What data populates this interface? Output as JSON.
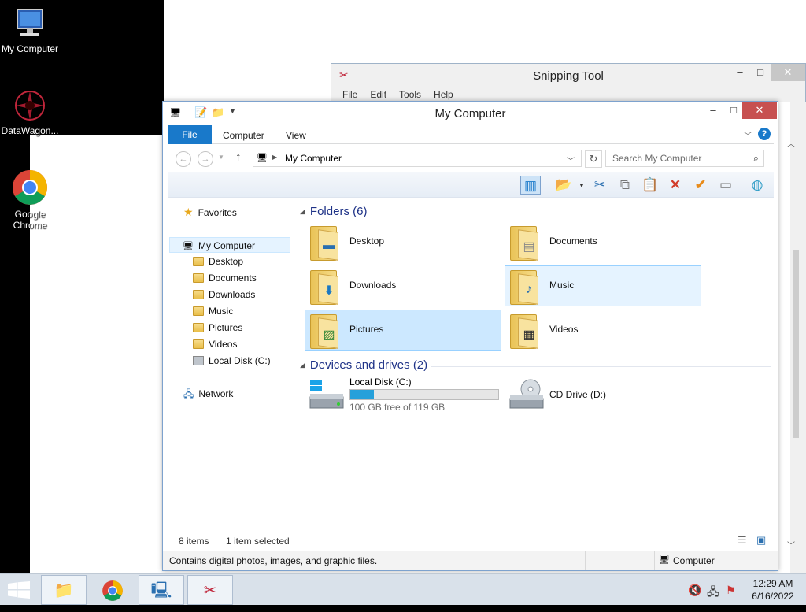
{
  "desktop": {
    "icons": [
      {
        "label": "My Computer",
        "icon": "computer-icon"
      },
      {
        "label": "DataWagon...",
        "icon": "datawagon-icon"
      },
      {
        "label": "Google Chrome",
        "icon": "chrome-icon"
      }
    ]
  },
  "snipping_tool": {
    "title": "Snipping Tool",
    "menu": [
      "File",
      "Edit",
      "Tools",
      "Help"
    ],
    "controls": {
      "minimize": "–",
      "maximize": "□",
      "close": "✕"
    }
  },
  "explorer": {
    "title": "My Computer",
    "controls": {
      "minimize": "–",
      "maximize": "□",
      "close": "✕"
    },
    "ribbon_tabs": [
      "File",
      "Computer",
      "View"
    ],
    "address": {
      "path": "My Computer"
    },
    "search": {
      "placeholder": "Search My Computer"
    },
    "nav": {
      "favorites": "Favorites",
      "my_computer": "My Computer",
      "children": [
        "Desktop",
        "Documents",
        "Downloads",
        "Music",
        "Pictures",
        "Videos",
        "Local Disk (C:)"
      ],
      "network": "Network"
    },
    "groups": {
      "folders": {
        "title": "Folders (6)",
        "items": [
          "Desktop",
          "Documents",
          "Downloads",
          "Music",
          "Pictures",
          "Videos"
        ]
      },
      "devices": {
        "title": "Devices and drives (2)"
      }
    },
    "drives": [
      {
        "name": "Local Disk (C:)",
        "free_text": "100 GB free of 119 GB",
        "used_fraction": 0.16
      },
      {
        "name": "CD Drive (D:)"
      }
    ],
    "status": {
      "items": "8 items",
      "selected": "1 item selected"
    },
    "statusbar": {
      "description": "Contains digital photos, images, and graphic files.",
      "location": "Computer"
    }
  },
  "taskbar": {
    "clock": {
      "time": "12:29 AM",
      "date": "6/16/2022"
    }
  },
  "colors": {
    "accent": "#1979ca",
    "selection": "#cce8ff",
    "close": "#c75050"
  }
}
